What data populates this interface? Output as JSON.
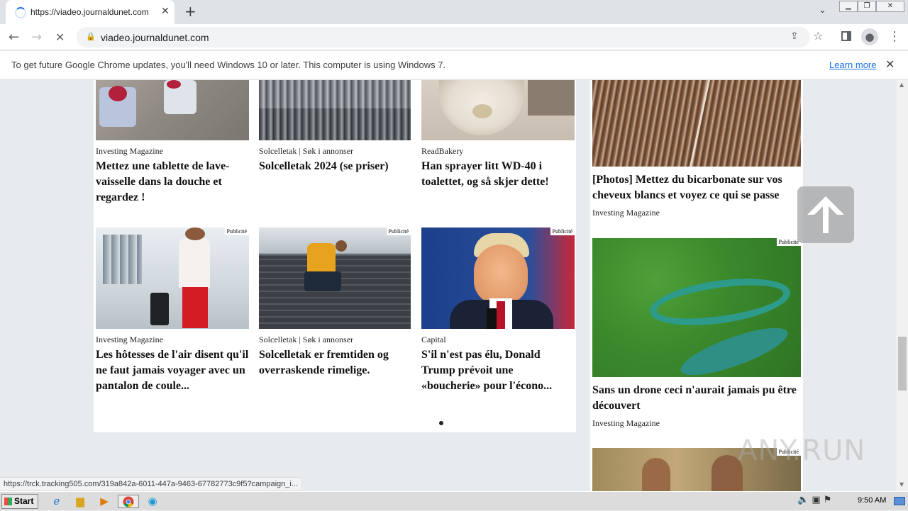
{
  "browser": {
    "tab_title": "https://viadeo.journaldunet.com",
    "url": "viadeo.journaldunet.com",
    "new_tab_label": "+",
    "infobar_text": "To get future Google Chrome updates, you'll need Windows 10 or later. This computer is using Windows 7.",
    "infobar_link": "Learn more",
    "status_url": "https://trck.tracking505.com/319a842a-6011-447a-9463-67782773c9f5?campaign_i..."
  },
  "feed": {
    "badge_label": "Publicité",
    "row1": [
      {
        "source": "Investing Magazine",
        "headline": "Mettez une tablette de lave-vaisselle dans la douche et regardez !"
      },
      {
        "source": "Solcelletak | Søk i annonser",
        "headline": "Solcelletak 2024 (se priser)"
      },
      {
        "source": "ReadBakery",
        "headline": "Han sprayer litt WD-40 i toalettet, og så skjer dette!"
      }
    ],
    "row2": [
      {
        "source": "Investing Magazine",
        "headline": "Les hôtesses de l'air disent qu'il ne faut jamais voyager avec un pantalon de coule..."
      },
      {
        "source": "Solcelletak | Søk i annonser",
        "headline": "Solcelletak er fremtiden og overraskende rimelige."
      },
      {
        "source": "Capital",
        "headline": "S'il n'est pas élu, Donald Trump prévoit une «boucherie» pour l'écono..."
      }
    ]
  },
  "sidebar": {
    "items": [
      {
        "headline": "[Photos] Mettez du bicarbonate sur vos cheveux blancs et voyez ce qui se passe",
        "source": "Investing Magazine"
      },
      {
        "headline": "Sans un drone ceci n'aurait jamais pu être découvert",
        "source": "Investing Magazine"
      }
    ]
  },
  "watermark": "ANY.RUN",
  "taskbar": {
    "start_label": "Start",
    "clock": "9:50 AM"
  }
}
